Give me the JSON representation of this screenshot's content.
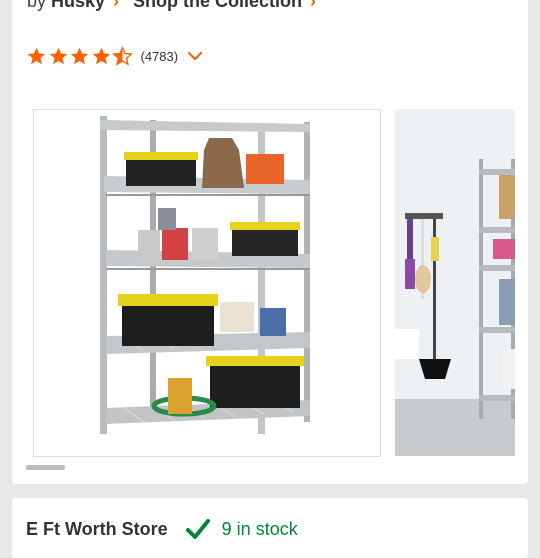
{
  "brand": {
    "by": "by",
    "name": "Husky",
    "collection": "Shop the Collection"
  },
  "rating": {
    "stars": 4.5,
    "max_stars": 5,
    "count": "(4783)"
  },
  "store": {
    "name": "E Ft Worth Store",
    "stock": "9 in stock"
  },
  "gallery": {
    "current_index": 1,
    "total_visible": 2
  },
  "colors": {
    "accent": "#f96302",
    "star": "#f96302",
    "in_stock": "#00873c"
  }
}
